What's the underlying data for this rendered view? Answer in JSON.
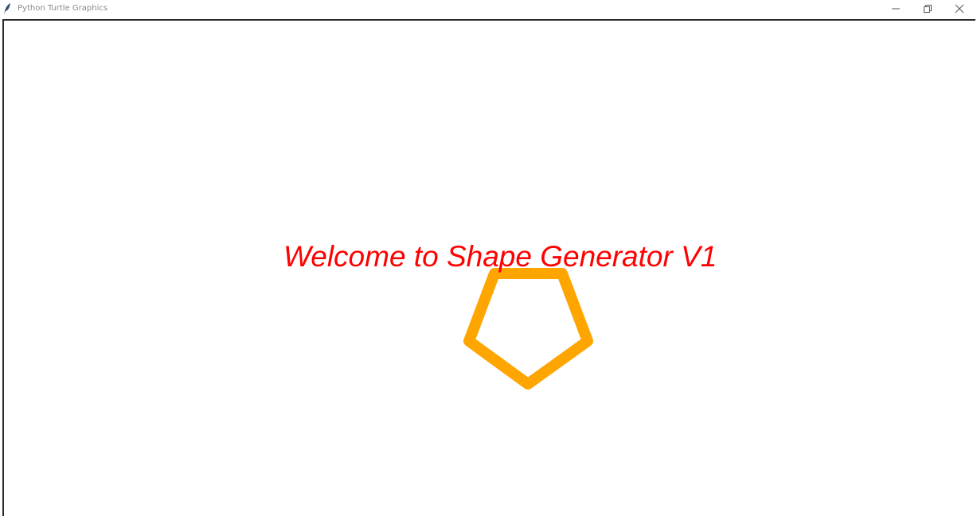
{
  "window": {
    "title": "Python Turtle Graphics",
    "icon": "feather-icon"
  },
  "controls": {
    "minimize_icon": "minimize-icon",
    "restore_icon": "restore-icon",
    "close_icon": "close-icon"
  },
  "canvas": {
    "welcome_text": "Welcome to Shape Generator V1",
    "welcome_color": "#ff0000",
    "shape": {
      "type": "pentagon",
      "stroke_color": "#ffa500",
      "fill": "none"
    }
  }
}
